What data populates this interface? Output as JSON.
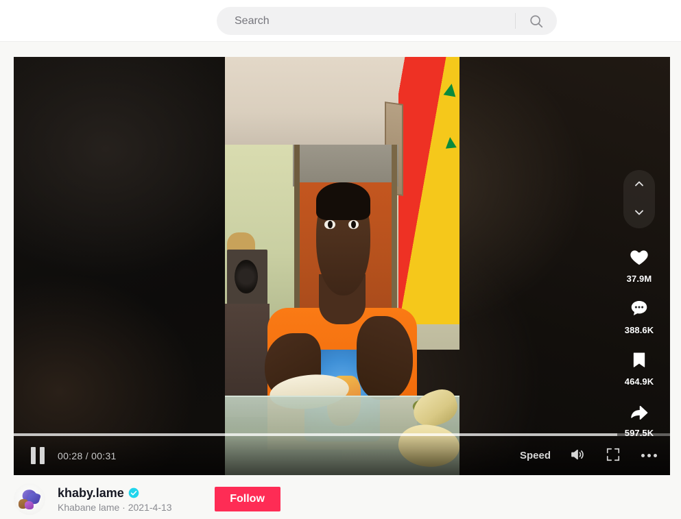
{
  "header": {
    "search": {
      "placeholder": "Search",
      "value": "",
      "icon": "search-icon"
    }
  },
  "player": {
    "nav": {
      "prev_icon": "chevron-up-icon",
      "next_icon": "chevron-down-icon"
    },
    "actions": [
      {
        "name": "like",
        "icon": "heart-icon",
        "count": "37.9M"
      },
      {
        "name": "comment",
        "icon": "comment-icon",
        "count": "388.6K"
      },
      {
        "name": "favorite",
        "icon": "bookmark-icon",
        "count": "464.9K"
      },
      {
        "name": "share",
        "icon": "share-icon",
        "count": "597.5K"
      }
    ],
    "controls": {
      "play_state": "paused",
      "pause_icon": "pause-icon",
      "current_time": "00:28",
      "duration": "00:31",
      "time_display": "00:28 / 00:31",
      "progress_percent": 92,
      "speed_label": "Speed",
      "volume_icon": "volume-on-icon",
      "fullscreen_icon": "fullscreen-icon",
      "more_icon": "more-options-icon"
    },
    "video_scene": {
      "description": "Man in orange Naruto t-shirt holding a peeled banana over a glass table with banana peels; room with beige ceiling, orange door and Senegal flag on the wall"
    }
  },
  "author": {
    "avatar_alt": "khaby.lame avatar",
    "unique_id": "khaby.lame",
    "verified": true,
    "verified_icon": "verified-badge-icon",
    "nickname": "Khabane lame",
    "separator": "·",
    "create_date": "2021-4-13",
    "meta_line": "Khabane lame · 2021-4-13",
    "follow_label": "Follow"
  },
  "colors": {
    "brand_red": "#FE2C55",
    "verified_blue": "#20D5EC",
    "page_bg": "#F8F8F6",
    "header_bg": "#FFFFFF",
    "search_bg": "#F1F1F2",
    "text_primary": "#161823",
    "text_secondary": "#8A8B91"
  }
}
